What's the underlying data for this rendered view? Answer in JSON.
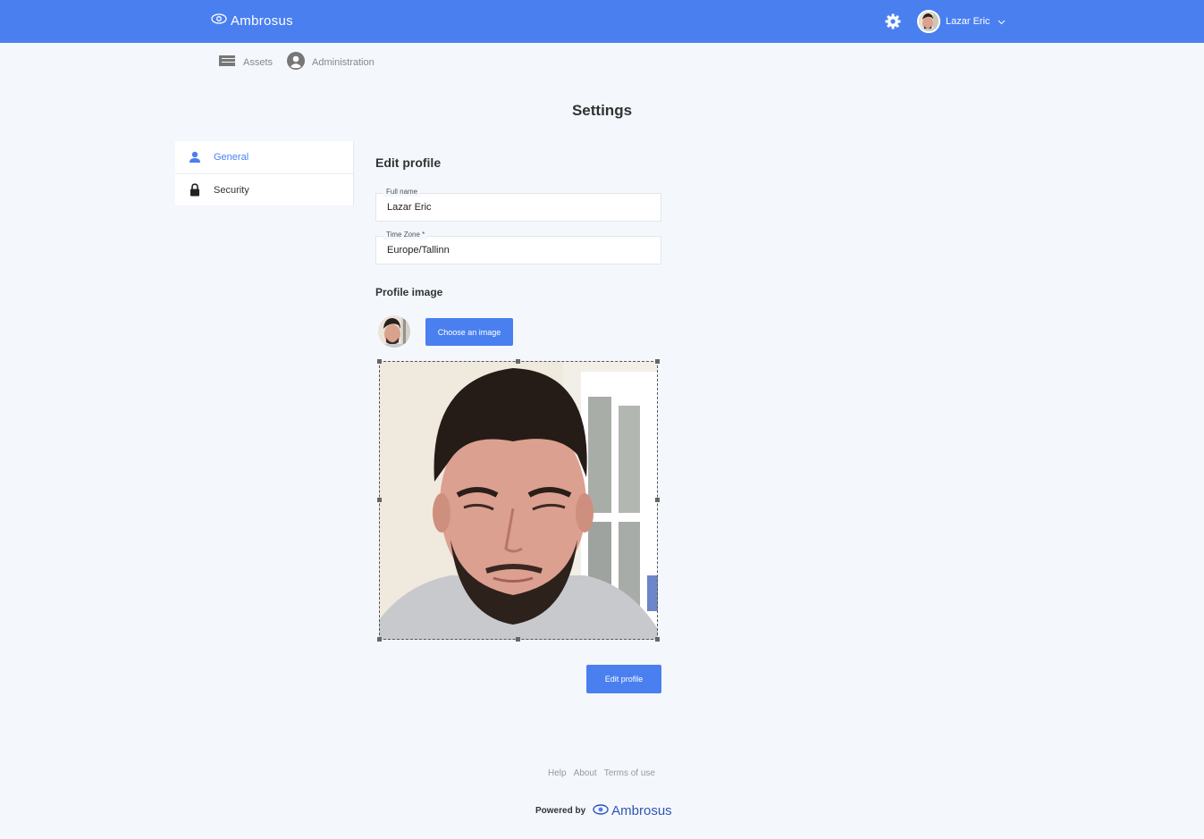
{
  "header": {
    "brand": "Ambrosus",
    "user_name": "Lazar Eric",
    "icons": [
      "eye-logo-icon",
      "gear-icon",
      "chevron-down-icon"
    ]
  },
  "subnav": {
    "assets": "Assets",
    "administration": "Administration"
  },
  "page_title": "Settings",
  "sidemenu": {
    "items": [
      {
        "label": "General",
        "icon": "user-icon",
        "active": true
      },
      {
        "label": "Security",
        "icon": "lock-icon",
        "active": false
      }
    ]
  },
  "form": {
    "section_title": "Edit profile",
    "full_name_label": "Full name",
    "full_name_value": "Lazar Eric",
    "timezone_label": "Time Zone *",
    "timezone_value": "Europe/Tallinn",
    "profile_image_title": "Profile image",
    "choose_image_label": "Choose an image",
    "submit_label": "Edit profile"
  },
  "footer": {
    "links": [
      "Help",
      "About",
      "Terms of use"
    ],
    "powered_by": "Powered by",
    "brand": "Ambrosus"
  },
  "colors": {
    "primary": "#4a7ff0",
    "background": "#f4f7fc",
    "brand_dark": "#2f55b8"
  }
}
